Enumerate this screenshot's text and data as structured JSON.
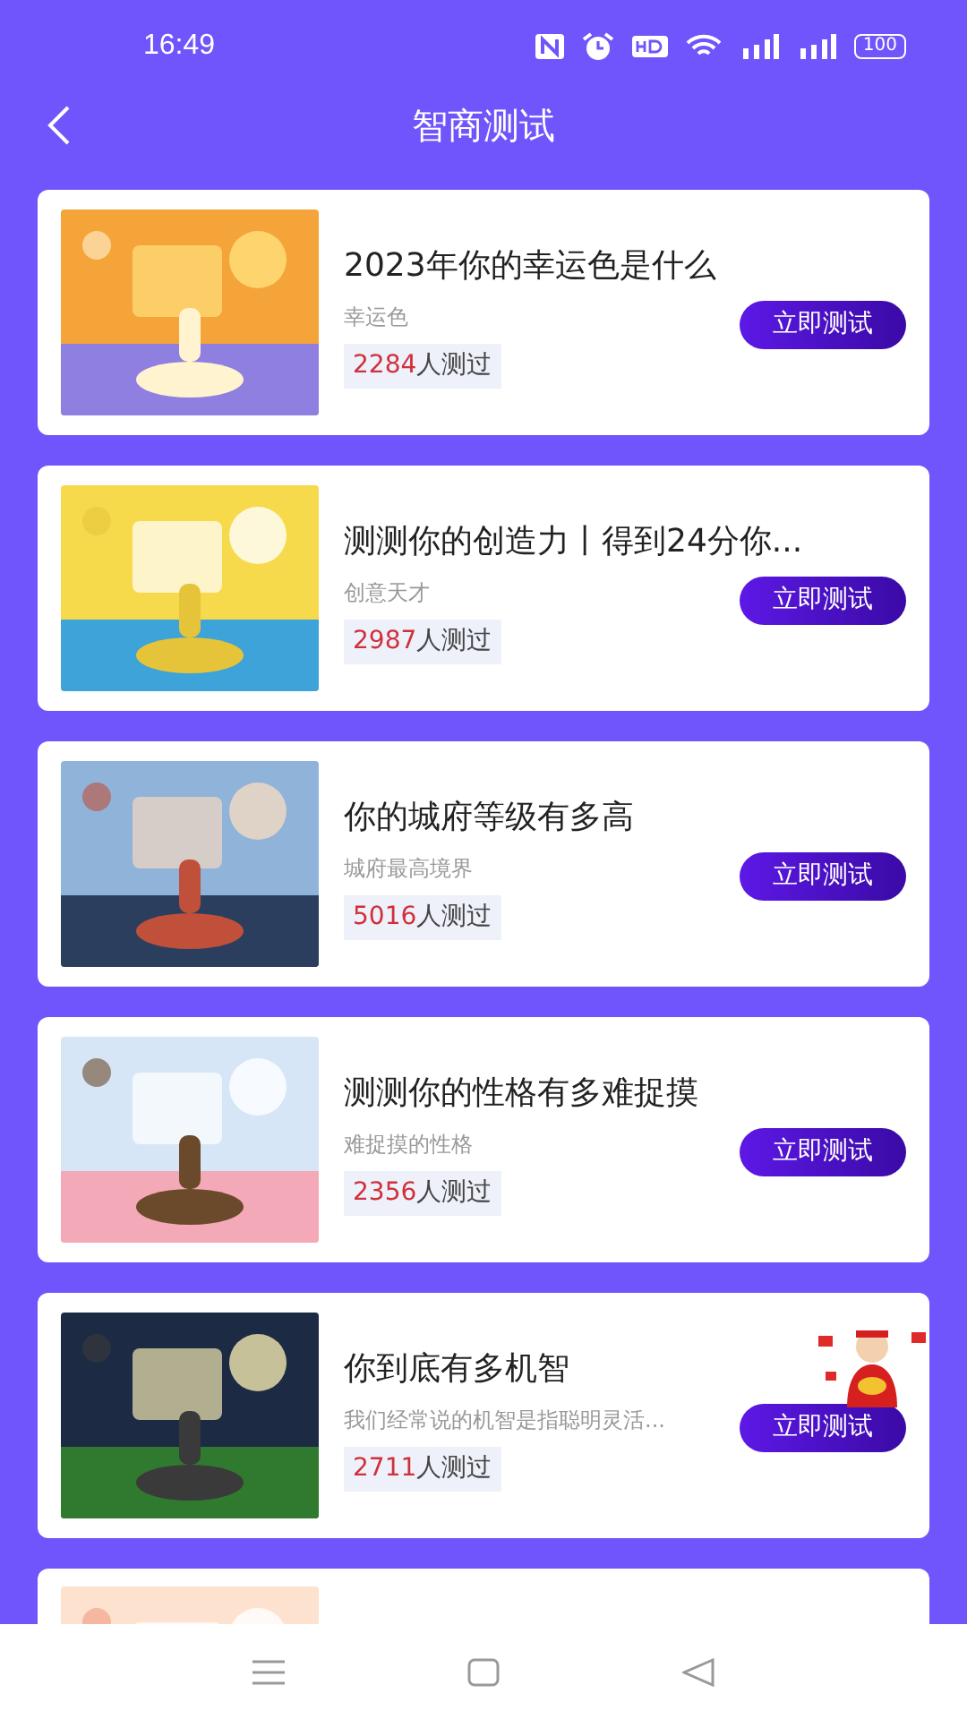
{
  "status_bar": {
    "time": "16:49",
    "battery": "100"
  },
  "header": {
    "title": "智商测试"
  },
  "tests": [
    {
      "kind": "full",
      "title": "2023年你的幸运色是什么",
      "subtitle": "幸运色",
      "count": "2284",
      "count_suffix": "人测过",
      "button": "立即测试",
      "mascot": false
    },
    {
      "kind": "full",
      "title": "测测你的创造力丨得到24分你...",
      "subtitle": "创意天才",
      "count": "2987",
      "count_suffix": "人测过",
      "button": "立即测试",
      "mascot": false
    },
    {
      "kind": "full",
      "title": "你的城府等级有多高",
      "subtitle": "城府最高境界",
      "count": "5016",
      "count_suffix": "人测过",
      "button": "立即测试",
      "mascot": false
    },
    {
      "kind": "full",
      "title": "测测你的性格有多难捉摸",
      "subtitle": "难捉摸的性格",
      "count": "2356",
      "count_suffix": "人测过",
      "button": "立即测试",
      "mascot": false
    },
    {
      "kind": "full",
      "title": "你到底有多机智",
      "subtitle": "我们经常说的机智是指聪明灵活...",
      "count": "2711",
      "count_suffix": "人测过",
      "button": "立即测试",
      "mascot": true
    },
    {
      "kind": "partial"
    }
  ]
}
